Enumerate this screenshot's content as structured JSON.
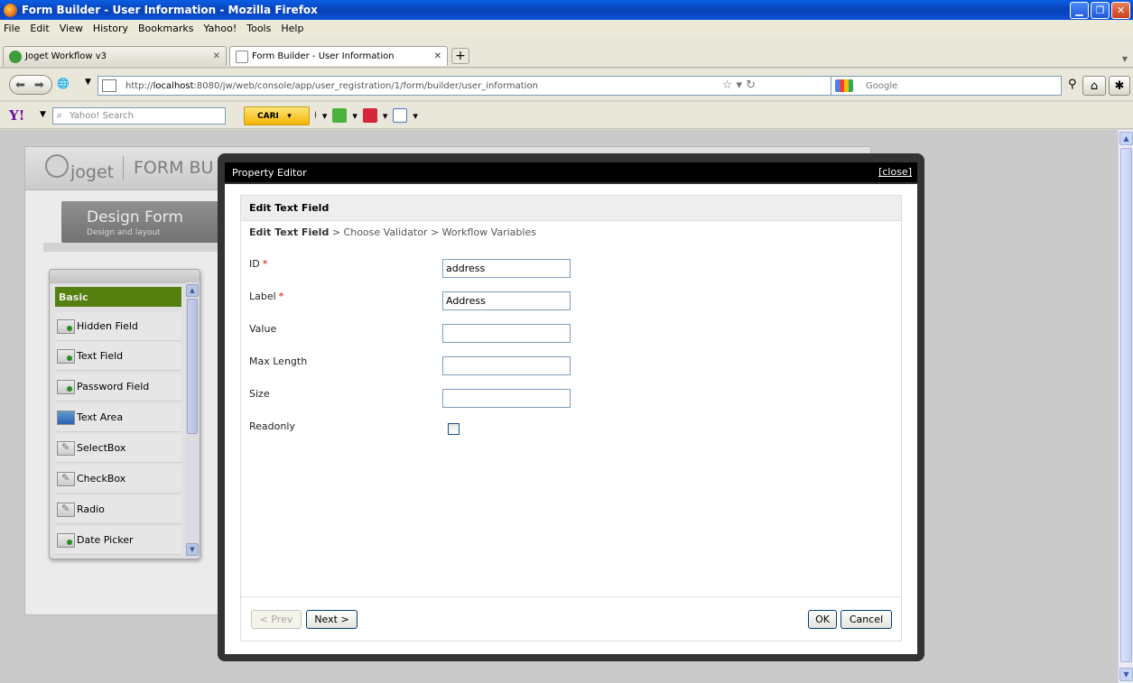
{
  "window": {
    "title": "Form Builder - User Information - Mozilla Firefox"
  },
  "menu": [
    "File",
    "Edit",
    "View",
    "History",
    "Bookmarks",
    "Yahoo!",
    "Tools",
    "Help"
  ],
  "tabs": [
    {
      "label": "Joget Workflow v3",
      "active": false
    },
    {
      "label": "Form Builder - User Information",
      "active": true
    }
  ],
  "nav": {
    "url_prefix": "http://",
    "url_host": "localhost",
    "url_rest": ":8080/jw/web/console/app/user_registration/1/form/builder/user_information",
    "search_placeholder": "Google"
  },
  "yahoo": {
    "search_placeholder": "Yahoo! Search",
    "search_button": "CARI"
  },
  "builder": {
    "brand": "joget",
    "title": "FORM BU",
    "design_tab_title": "Design Form",
    "design_tab_subtitle": "Design and layout"
  },
  "palette": {
    "category": "Basic",
    "items": [
      "Hidden Field",
      "Text Field",
      "Password Field",
      "Text Area",
      "SelectBox",
      "CheckBox",
      "Radio",
      "Date Picker"
    ]
  },
  "modal": {
    "title": "Property Editor",
    "close_label": "[close]",
    "panel_title": "Edit Text Field",
    "breadcrumb": {
      "current": "Edit Text Field",
      "rest": " > Choose Validator > Workflow Variables"
    },
    "fields": {
      "id_label": "ID",
      "id_value": "address",
      "label_label": "Label",
      "label_value": "Address",
      "value_label": "Value",
      "value_value": "",
      "maxlength_label": "Max Length",
      "maxlength_value": "",
      "size_label": "Size",
      "size_value": "",
      "readonly_label": "Readonly",
      "required_mark": "*"
    },
    "buttons": {
      "prev": "< Prev",
      "next": "Next >",
      "ok": "OK",
      "cancel": "Cancel"
    }
  }
}
